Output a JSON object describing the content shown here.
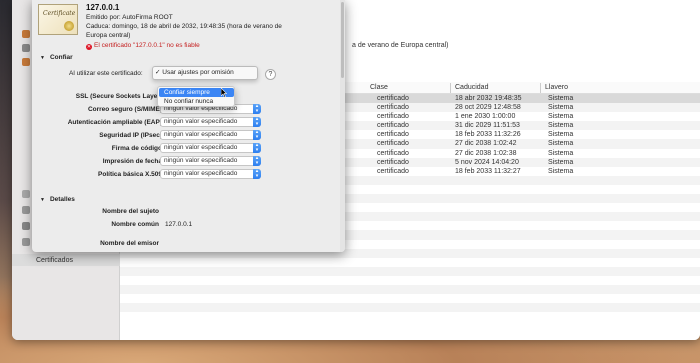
{
  "certificate": {
    "name": "127.0.0.1",
    "issuer": "Emitido por: AutoFirma ROOT",
    "expiry_line1": "Caduca: domingo, 18 de abril de 2032, 19:48:35 (hora de verano de",
    "expiry_line2": "Europa central)",
    "warning": "El certificado \"127.0.0.1\" no es fiable",
    "thumb_text": "Certificate"
  },
  "trust": {
    "section_title": "Confiar",
    "when_using_label": "Al utilizar este certificado:",
    "selected_option": "✓ Usar ajustes por omisión",
    "help_label": "?",
    "menu_options": [
      "Confiar siempre",
      "No confiar nunca"
    ],
    "rows": [
      {
        "label": "SSL (Secure Sockets Layer)",
        "value": ""
      },
      {
        "label": "Correo seguro (S/MIME)",
        "value": "ningún valor especificado"
      },
      {
        "label": "Autenticación ampliable (EAP)",
        "value": "ningún valor especificado"
      },
      {
        "label": "Seguridad IP (IPsec)",
        "value": "ningún valor especificado"
      },
      {
        "label": "Firma de código",
        "value": "ningún valor especificado"
      },
      {
        "label": "Impresión de fecha",
        "value": "ningún valor especificado"
      },
      {
        "label": "Política básica X.509",
        "value": "ningún valor especificado"
      }
    ]
  },
  "details": {
    "section_title": "Detalles",
    "subject_name_label": "Nombre del sujeto",
    "common_name_label": "Nombre común",
    "common_name_value": "127.0.0.1",
    "issuer_name_label": "Nombre del emisor"
  },
  "main_window": {
    "header_text": "a de verano de Europa central)",
    "sidebar_bottom_label": "Certificados",
    "columns": [
      "Clase",
      "Caducidad",
      "Llavero"
    ],
    "rows": [
      {
        "kind": "certificado",
        "expires": "18 abr 2032 19:48:35",
        "keychain": "Sistema"
      },
      {
        "kind": "certificado",
        "expires": "28 oct 2029 12:48:58",
        "keychain": "Sistema"
      },
      {
        "kind": "certificado",
        "expires": "1 ene 2030 1:00:00",
        "keychain": "Sistema"
      },
      {
        "kind": "certificado",
        "expires": "31 dic 2029 11:51:53",
        "keychain": "Sistema"
      },
      {
        "kind": "certificado",
        "expires": "18 feb 2033 11:32:26",
        "keychain": "Sistema"
      },
      {
        "kind": "certificado",
        "expires": "27 dic 2038 1:02:42",
        "keychain": "Sistema"
      },
      {
        "kind": "certificado",
        "expires": "27 dic 2038 1:02:38",
        "keychain": "Sistema"
      },
      {
        "kind": "certificado",
        "expires": "5 nov 2024 14:04:20",
        "keychain": "Sistema"
      },
      {
        "kind": "certificado",
        "expires": "18 feb 2033 11:32:27",
        "keychain": "Sistema"
      }
    ]
  },
  "colors": {
    "accent": "#3b85f4",
    "warning": "#c41e1e"
  }
}
